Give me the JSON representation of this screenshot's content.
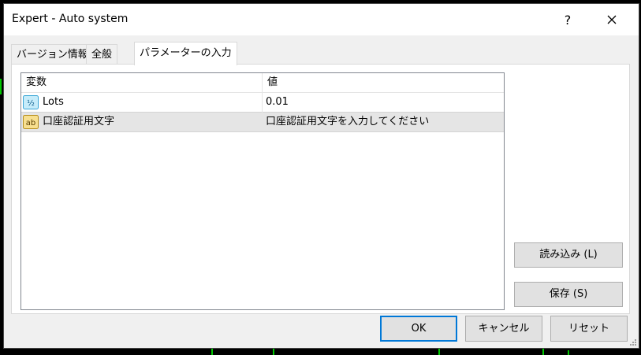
{
  "window": {
    "title": "Expert - Auto system",
    "help_glyph": "?",
    "close_glyph": "✕"
  },
  "tabs": [
    {
      "label": "バージョン情報",
      "active": false
    },
    {
      "label": "全般",
      "active": false
    },
    {
      "label": "パラメーターの入力",
      "active": true
    }
  ],
  "params_table": {
    "columns": [
      "変数",
      "値"
    ],
    "rows": [
      {
        "icon": "numeric-param-icon",
        "icon_text": "½",
        "name": "Lots",
        "value": "0.01",
        "selected": false
      },
      {
        "icon": "string-param-icon",
        "icon_text": "ab",
        "name": "口座認証用文字",
        "value": "口座認証用文字を入力してください",
        "selected": true
      }
    ]
  },
  "side_buttons": {
    "load_label": "読み込み (L)",
    "save_label": "保存 (S)"
  },
  "footer_buttons": {
    "ok_label": "OK",
    "cancel_label": "キャンセル",
    "reset_label": "リセット"
  },
  "colors": {
    "background": "#000000",
    "dialog": "#f0f0f0",
    "default_button_border": "#0078d7",
    "selected_row": "#e5e5e5",
    "chart_green": "#00c800"
  }
}
